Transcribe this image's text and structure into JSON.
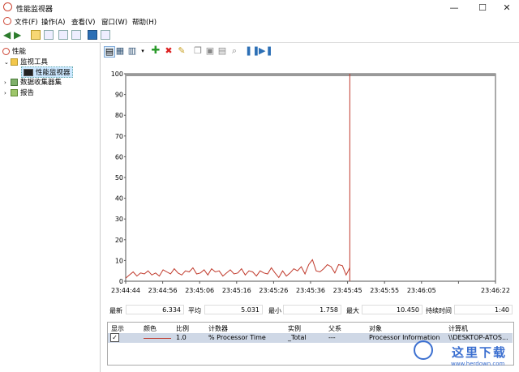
{
  "window": {
    "title": "性能监视器",
    "controls": [
      "—",
      "☐",
      "✕"
    ]
  },
  "menu": [
    "文件(F)",
    "操作(A)",
    "查看(V)",
    "窗口(W)",
    "帮助(H)"
  ],
  "tree": {
    "root": "性能",
    "monitoring_tools": "监视工具",
    "performance_monitor": "性能监视器",
    "data_collector_sets": "数据收集器集",
    "reports": "报告"
  },
  "chart_data": {
    "type": "line",
    "ylim": [
      0,
      100
    ],
    "yticks": [
      0,
      10,
      20,
      30,
      40,
      50,
      60,
      70,
      80,
      90,
      100
    ],
    "xticks": [
      "23:44:44",
      "23:44:56",
      "23:45:06",
      "23:45:16",
      "23:45:26",
      "23:45:36",
      "23:45:45",
      "23:45:55",
      "23:46:05",
      "",
      "23:46:22"
    ],
    "cursor_index": 60,
    "total_slots": 100,
    "values": [
      1.5,
      3,
      4.5,
      2.5,
      4,
      3.5,
      5,
      3,
      4,
      2.5,
      5.5,
      4.5,
      3.5,
      6,
      4,
      3,
      5,
      4.5,
      6.5,
      3.5,
      4,
      5.5,
      3,
      6,
      4.5,
      5,
      2.5,
      4,
      5.5,
      3.5,
      4,
      6,
      3,
      5,
      4.5,
      2.5,
      5,
      4,
      3.5,
      6.5,
      4,
      1.8,
      5,
      2.5,
      4,
      6,
      5,
      7,
      3.5,
      8,
      10.4,
      5,
      4.5,
      6,
      8,
      7,
      4,
      8,
      7.5,
      3,
      6.5
    ],
    "line_color": "#c0392b"
  },
  "stats": {
    "last_label": "最新",
    "last_value": "6.334",
    "avg_label": "平均",
    "avg_value": "5.031",
    "min_label": "最小",
    "min_value": "1.758",
    "max_label": "最大",
    "max_value": "10.450",
    "duration_label": "持续时间",
    "duration_value": "1:40"
  },
  "counters": {
    "headers": [
      "显示",
      "颜色",
      "比例",
      "计数器",
      "实例",
      "父系",
      "对象",
      "计算机"
    ],
    "row": {
      "show": "✓",
      "scale": "1.0",
      "counter": "% Processor Time",
      "instance": "_Total",
      "parent": "---",
      "object": "Processor Information",
      "computer": "\\\\DESKTOP-ATOS..."
    }
  },
  "watermark": {
    "text": "这里下载",
    "url": "www.herdown.com"
  }
}
